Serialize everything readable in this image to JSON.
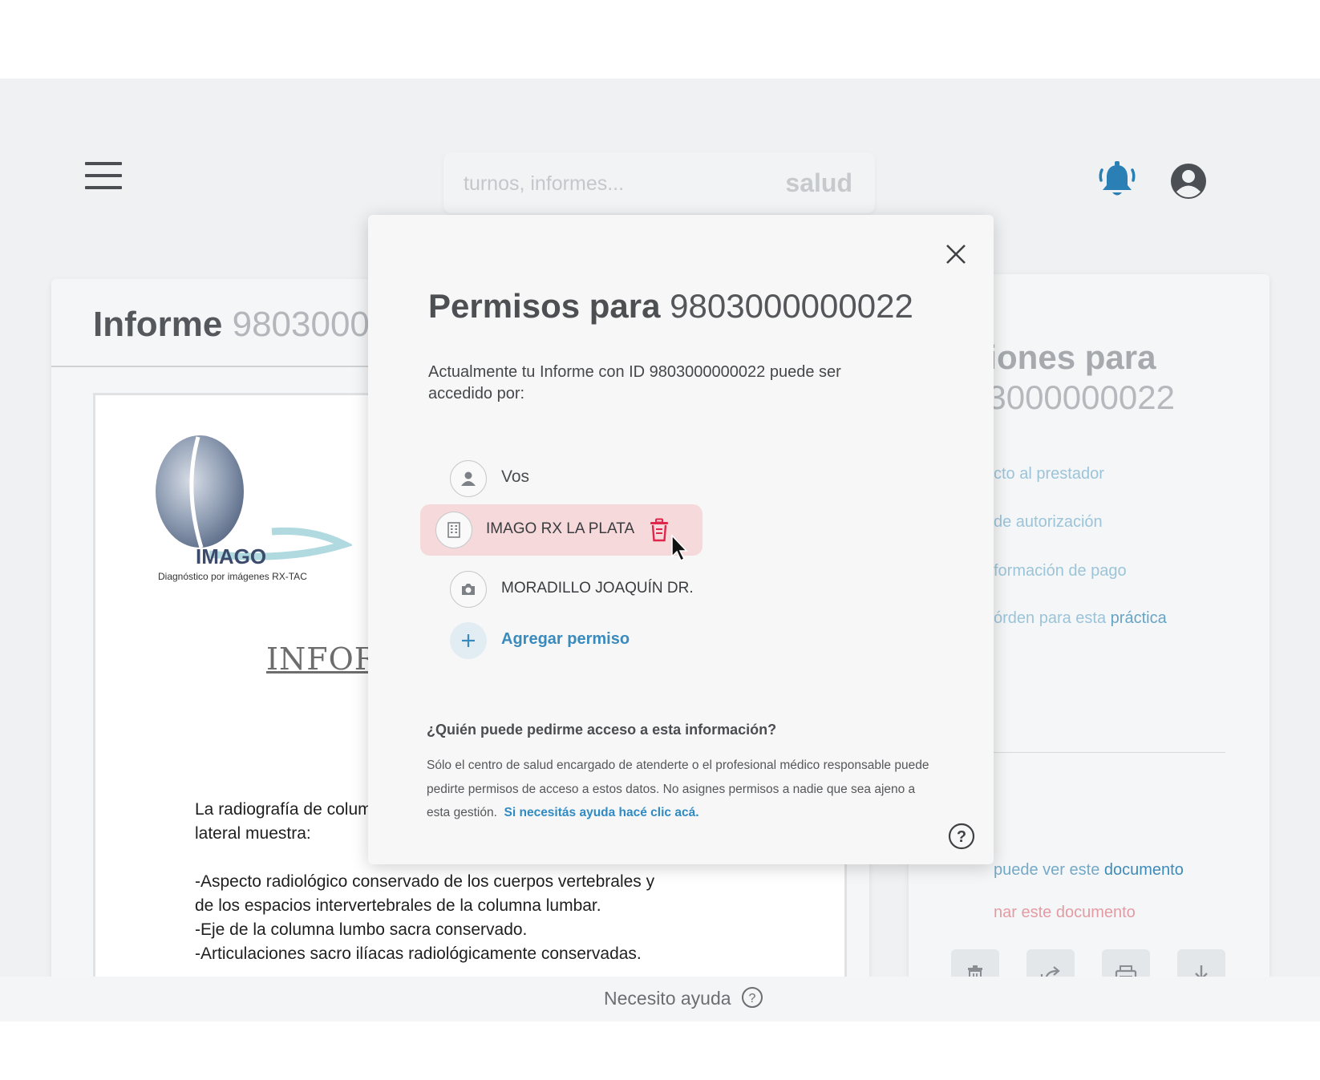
{
  "header": {
    "search_placeholder": "turnos, informes...",
    "brand_text": "salud"
  },
  "report_card": {
    "title_bold": "Informe",
    "title_id": "98030000000022",
    "document": {
      "logo_text": "IMAGO",
      "logo_subtext": "Diagnóstico por imágenes  RX-TAC",
      "heading": "INFORME",
      "body": "La radiografía de columna lumbo sacra frente y\nlateral muestra:\n\n-Aspecto radiológico conservado de los cuerpos vertebrales y\nde los espacios intervertebrales de la columna lumbar.\n-Eje de la columna lumbo sacra conservado.\n-Articulaciones sacro ilíacas radiológicamente conservadas."
    }
  },
  "actions_card": {
    "title_line1": "ciones para",
    "title_line2": "03000000022",
    "links": [
      {
        "label_prefix": "cto al prestador",
        "label_strong": ""
      },
      {
        "label_prefix": " de autorización",
        "label_strong": ""
      },
      {
        "label_prefix": "formación de pago",
        "label_strong": ""
      },
      {
        "label_prefix": "órden para esta ",
        "label_strong": "práctica"
      }
    ],
    "link_who": {
      "label_prefix": " puede ver este ",
      "label_strong": "documento"
    },
    "link_delete": "nar este documento",
    "buttons": [
      "trash-icon",
      "share-icon",
      "print-icon",
      "download-icon"
    ]
  },
  "modal": {
    "title_bold": "Permisos para",
    "title_id": "9803000000022",
    "description": "Actualmente tu Informe con ID 9803000000022 puede ser accedido por:",
    "permissions": [
      {
        "label": "Vos",
        "icon": "person-icon",
        "selected": false
      },
      {
        "label": "IMAGO RX LA PLATA",
        "icon": "building-icon",
        "selected": true
      },
      {
        "label": "MORADILLO JOAQUÍN DR.",
        "icon": "camera-icon",
        "selected": false
      }
    ],
    "add_permission_label": "Agregar permiso",
    "question_title": "¿Quién puede pedirme acceso a esta información?",
    "question_text": "Sólo el centro de salud encargado de atenderte o el profesional médico responsable puede pedirte permisos de acceso a estos datos. No asignes permisos a nadie que sea ajeno a esta gestión.",
    "question_link": "Si necesitás ayuda hacé clic acá."
  },
  "footer": {
    "help_label": "Necesito ayuda"
  },
  "colors": {
    "accent_blue": "#2f8bc2",
    "danger_red": "#e0264b",
    "selected_row_bg": "#f5d9db",
    "bell_blue": "#2a7fb5"
  }
}
